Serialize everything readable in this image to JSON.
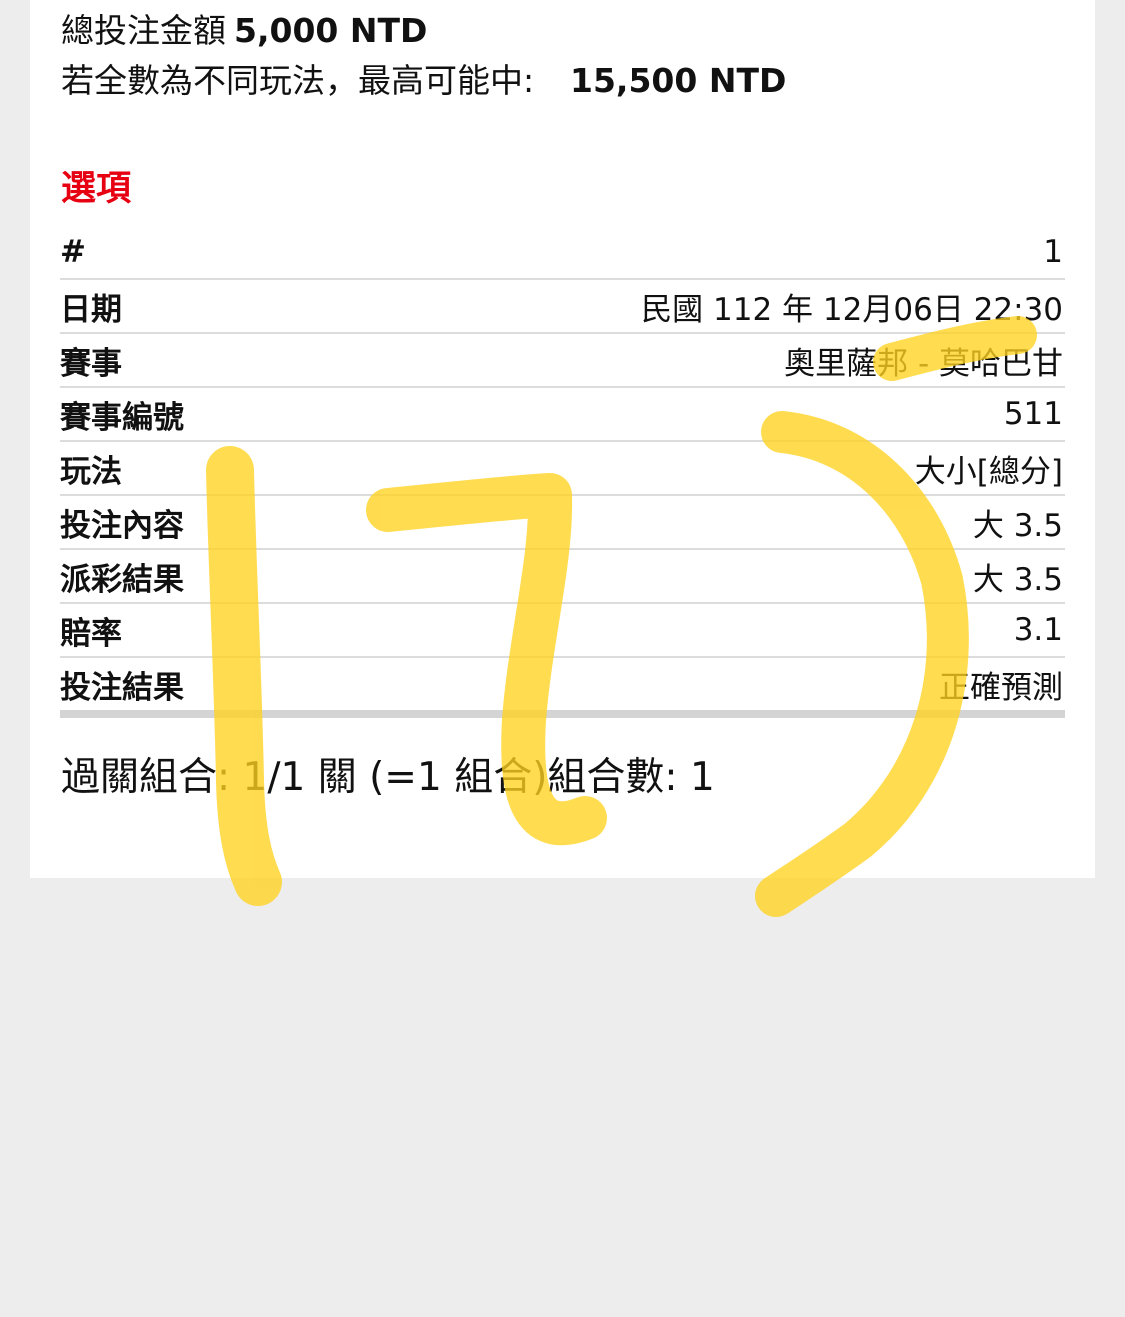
{
  "summary": {
    "total_label": "總投注金額",
    "total_value": "5,000 NTD",
    "max_label": "若全數為不同玩法，最高可能中:",
    "max_value": "15,500 NTD"
  },
  "options_heading": "選項",
  "colors": {
    "accent_red": "#e60012",
    "highlight_yellow": "#ffd21f"
  },
  "rows": [
    {
      "label": "#",
      "value": "1"
    },
    {
      "label": "日期",
      "value": "民國 112 年 12月06日 22:30"
    },
    {
      "label": "賽事",
      "value": "奧里薩邦 - 莫哈巴甘"
    },
    {
      "label": "賽事編號",
      "value": "511"
    },
    {
      "label": "玩法",
      "value": "大小[總分]"
    },
    {
      "label": "投注內容",
      "value": "大 3.5"
    },
    {
      "label": "派彩結果",
      "value": "大 3.5"
    },
    {
      "label": "賠率",
      "value": "3.1"
    },
    {
      "label": "投注結果",
      "value": "正確預測"
    }
  ],
  "parlay_text": "過關組合: 1/1 關 (=1 組合)組合數: 1"
}
